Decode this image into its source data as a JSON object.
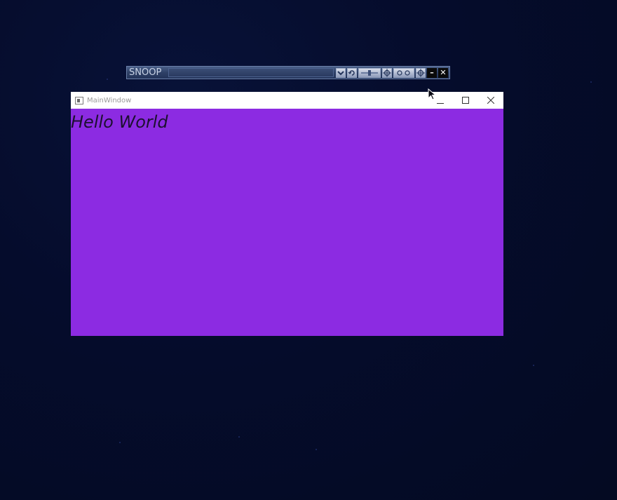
{
  "snoop": {
    "title": "SNOOP",
    "buttons": [
      {
        "icon": "chevron-down-icon"
      },
      {
        "icon": "refresh-icon"
      },
      {
        "icon": "slider-icon"
      },
      {
        "icon": "crosshair-icon"
      },
      {
        "icon": "snoop-targets-icon"
      },
      {
        "icon": "crosshair-icon"
      }
    ],
    "minimize_glyph": "–",
    "close_glyph": "✕"
  },
  "window": {
    "title": "MainWindow",
    "content_text": "Hello World",
    "background_color": "#8c2be2",
    "controls": [
      "minimize",
      "maximize",
      "close"
    ]
  }
}
